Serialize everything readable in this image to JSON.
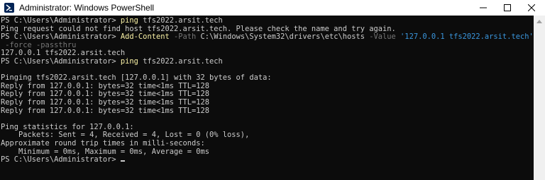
{
  "window": {
    "title": "Administrator: Windows PowerShell",
    "icon": "powershell-icon"
  },
  "console": {
    "lines": [
      [
        {
          "t": "PS C:\\Users\\Administrator> ",
          "c": ""
        },
        {
          "t": "ping",
          "c": "cmd"
        },
        {
          "t": " tfs2022.arsit.tech",
          "c": ""
        }
      ],
      [
        {
          "t": "Ping request could not find host tfs2022.arsit.tech. Please check the name and try again.",
          "c": ""
        }
      ],
      [
        {
          "t": "PS C:\\Users\\Administrator> ",
          "c": ""
        },
        {
          "t": "Add-Content",
          "c": "cmd"
        },
        {
          "t": " -Path",
          "c": "param"
        },
        {
          "t": " C:\\Windows\\System32\\drivers\\etc\\hosts",
          "c": ""
        },
        {
          "t": " -Value",
          "c": "param"
        },
        {
          "t": " '127.0.0.1 tfs2022.arsit.tech'",
          "c": "str"
        }
      ],
      [
        {
          "t": " -force -passthru",
          "c": "param"
        }
      ],
      [
        {
          "t": "127.0.0.1 tfs2022.arsit.tech",
          "c": ""
        }
      ],
      [
        {
          "t": "PS C:\\Users\\Administrator> ",
          "c": ""
        },
        {
          "t": "ping",
          "c": "cmd"
        },
        {
          "t": " tfs2022.arsit.tech",
          "c": ""
        }
      ],
      [],
      [
        {
          "t": "Pinging tfs2022.arsit.tech [127.0.0.1] with 32 bytes of data:",
          "c": ""
        }
      ],
      [
        {
          "t": "Reply from 127.0.0.1: bytes=32 time<1ms TTL=128",
          "c": ""
        }
      ],
      [
        {
          "t": "Reply from 127.0.0.1: bytes=32 time<1ms TTL=128",
          "c": ""
        }
      ],
      [
        {
          "t": "Reply from 127.0.0.1: bytes=32 time<1ms TTL=128",
          "c": ""
        }
      ],
      [
        {
          "t": "Reply from 127.0.0.1: bytes=32 time<1ms TTL=128",
          "c": ""
        }
      ],
      [],
      [
        {
          "t": "Ping statistics for 127.0.0.1:",
          "c": ""
        }
      ],
      [
        {
          "t": "    Packets: Sent = 4, Received = 4, Lost = 0 (0% loss),",
          "c": ""
        }
      ],
      [
        {
          "t": "Approximate round trip times in milli-seconds:",
          "c": ""
        }
      ],
      [
        {
          "t": "    Minimum = 0ms, Maximum = 0ms, Average = 0ms",
          "c": ""
        }
      ],
      [
        {
          "t": "PS C:\\Users\\Administrator> ",
          "c": ""
        }
      ]
    ],
    "cursor_line": 17
  },
  "colors": {
    "background": "#0c0c0c",
    "text": "#cccccc",
    "command": "#f9f1a5",
    "parameter": "#767676",
    "string": "#3a96dd"
  }
}
